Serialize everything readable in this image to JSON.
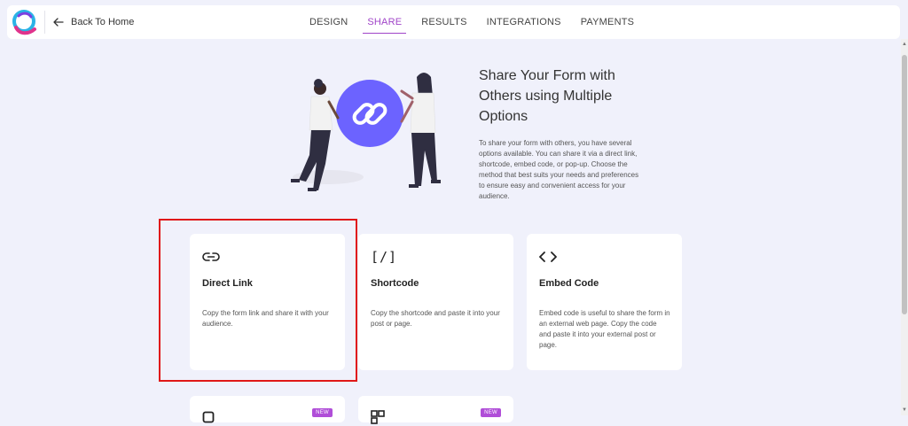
{
  "header": {
    "back_label": "Back To Home",
    "tabs": [
      {
        "label": "DESIGN",
        "active": false
      },
      {
        "label": "SHARE",
        "active": true
      },
      {
        "label": "RESULTS",
        "active": false
      },
      {
        "label": "INTEGRATIONS",
        "active": false
      },
      {
        "label": "PAYMENTS",
        "active": false
      }
    ]
  },
  "hero": {
    "title": "Share Your Form with Others using Multiple Options",
    "description": "To share your form with others, you have several options available. You can share it via a direct link, shortcode, embed code, or pop-up. Choose the method that best suits your needs and preferences to ensure easy and convenient access for your audience."
  },
  "cards": [
    {
      "icon": "link-icon",
      "title": "Direct Link",
      "description": "Copy the form link and share it with your audience."
    },
    {
      "icon": "shortcode-icon",
      "icon_text": "[/]",
      "title": "Shortcode",
      "description": "Copy the shortcode and paste it into your post or page."
    },
    {
      "icon": "code-icon",
      "title": "Embed Code",
      "description": "Embed code is useful to share the form in an external web page. Copy the code and paste it into your external post or page."
    }
  ],
  "partial_cards": [
    {
      "icon": "popup-icon",
      "badge": "NEW"
    },
    {
      "icon": "qr-code-icon",
      "badge": "NEW"
    }
  ],
  "colors": {
    "accent": "#a044c8",
    "badge": "#b04ed8",
    "highlight": "#e01818",
    "background": "#f0f1fb",
    "illustration_circle": "#6c63ff"
  }
}
